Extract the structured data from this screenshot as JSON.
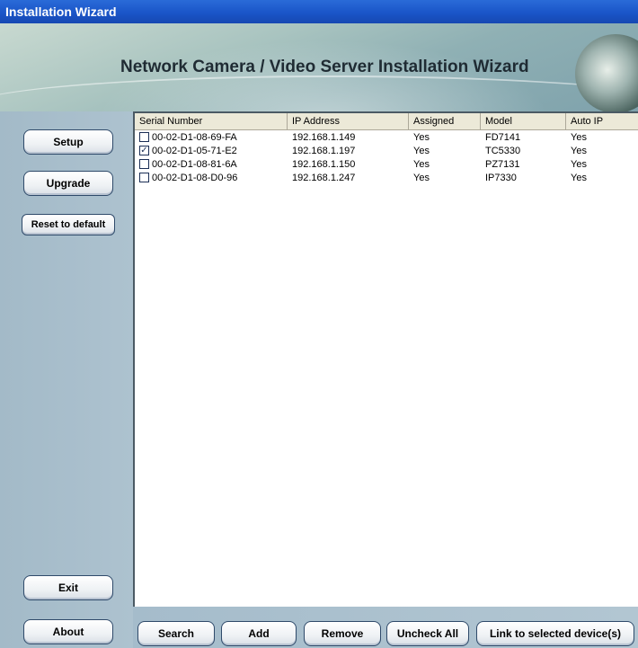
{
  "window": {
    "title": "Installation Wizard"
  },
  "banner": {
    "title": "Network Camera / Video Server Installation Wizard"
  },
  "sidebar": {
    "setup": "Setup",
    "upgrade": "Upgrade",
    "reset": "Reset to default",
    "exit": "Exit",
    "about": "About"
  },
  "table": {
    "columns": [
      "Serial Number",
      "IP Address",
      "Assigned",
      "Model",
      "Auto IP"
    ],
    "rows": [
      {
        "checked": false,
        "serial": "00-02-D1-08-69-FA",
        "ip": "192.168.1.149",
        "assigned": "Yes",
        "model": "FD7141",
        "auto_ip": "Yes"
      },
      {
        "checked": true,
        "serial": "00-02-D1-05-71-E2",
        "ip": "192.168.1.197",
        "assigned": "Yes",
        "model": "TC5330",
        "auto_ip": "Yes"
      },
      {
        "checked": false,
        "serial": "00-02-D1-08-81-6A",
        "ip": "192.168.1.150",
        "assigned": "Yes",
        "model": "PZ7131",
        "auto_ip": "Yes"
      },
      {
        "checked": false,
        "serial": "00-02-D1-08-D0-96",
        "ip": "192.168.1.247",
        "assigned": "Yes",
        "model": "IP7330",
        "auto_ip": "Yes"
      }
    ]
  },
  "bottom": {
    "search": "Search",
    "add": "Add",
    "remove": "Remove",
    "uncheck_all": "Uncheck All",
    "link": "Link to selected device(s)"
  },
  "colors": {
    "title_bar": "#1a55c8",
    "sidebar": "#a6bcc9",
    "header": "#ece9d8"
  }
}
